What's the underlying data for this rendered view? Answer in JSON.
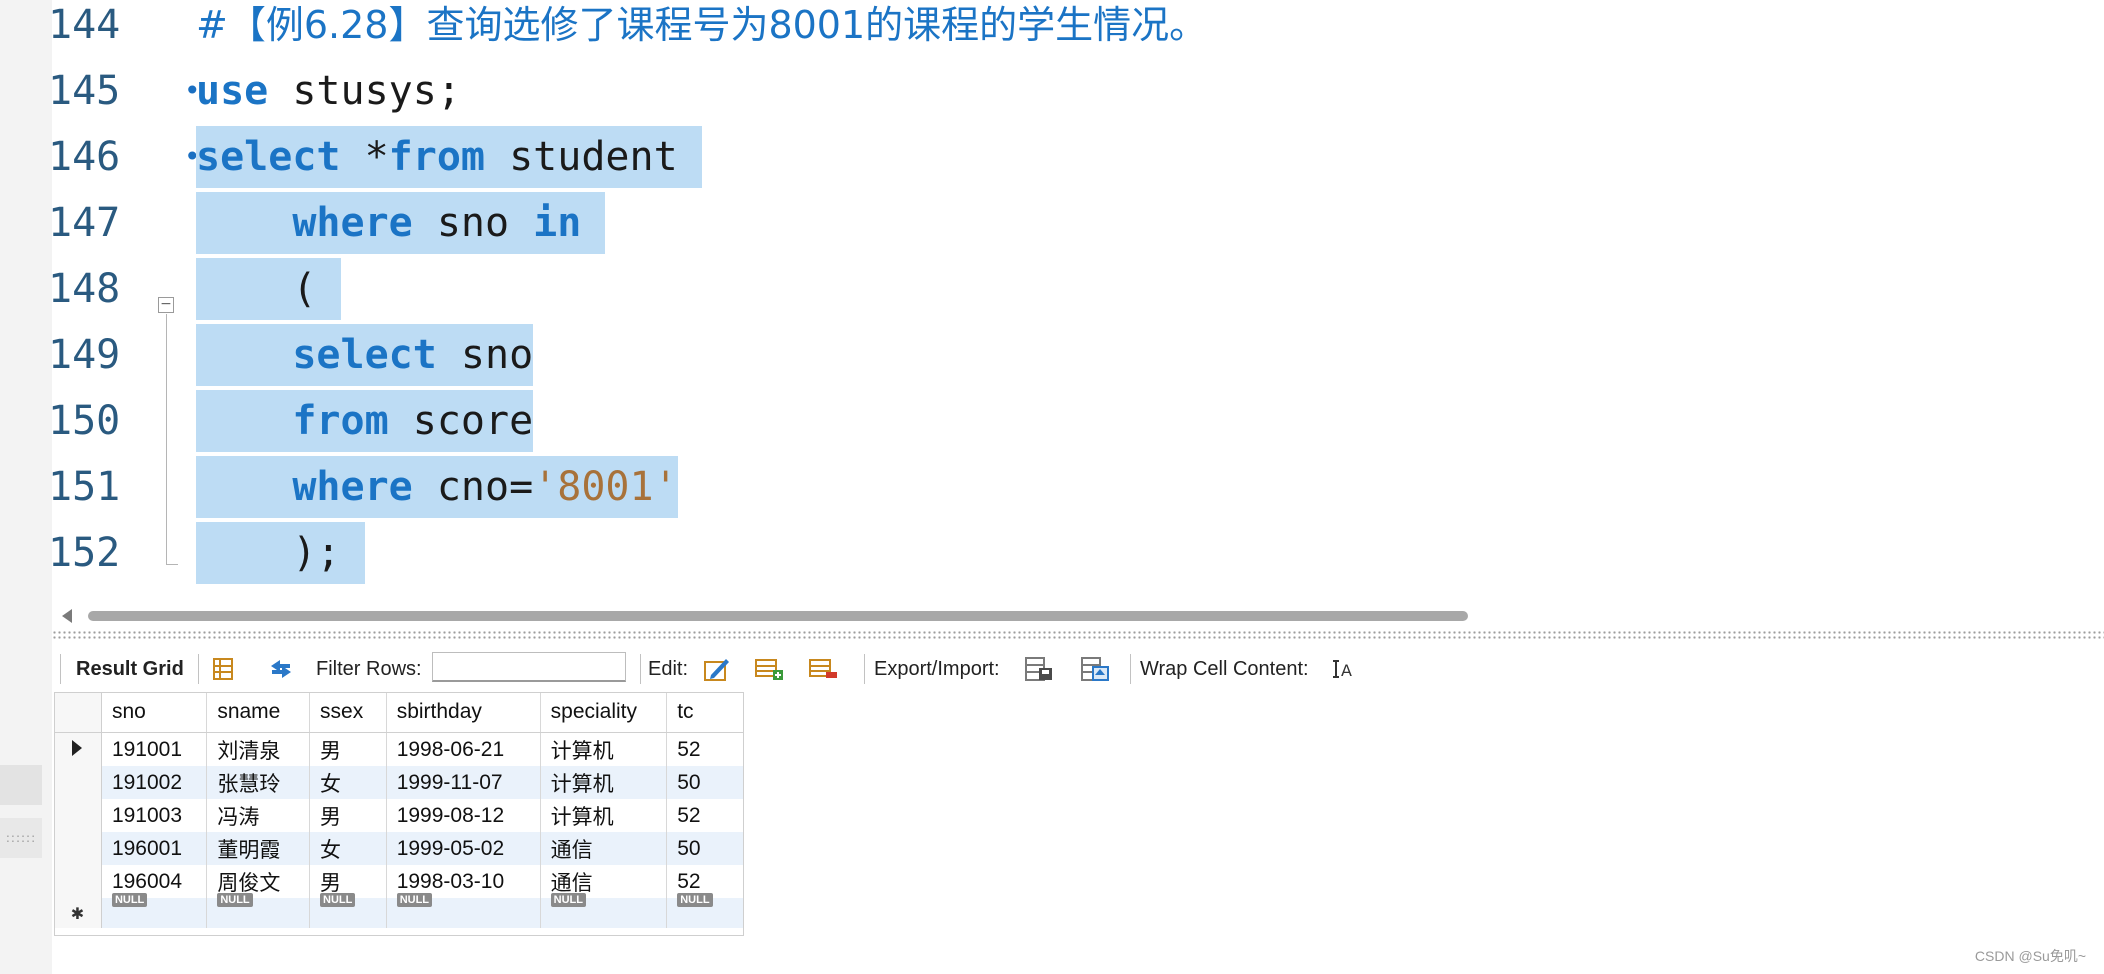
{
  "editor": {
    "lines": [
      {
        "num": "144",
        "tokens": [
          {
            "t": "#【例6.28】查询选修了课程号为8001的课程的学生情况。",
            "c": "cmt"
          }
        ]
      },
      {
        "num": "145",
        "marker": "•",
        "tokens": [
          {
            "t": "use",
            "c": "kw"
          },
          {
            "t": " stusys;"
          }
        ]
      },
      {
        "num": "146",
        "marker": "•",
        "tokens": [
          {
            "t": "select",
            "c": "kw"
          },
          {
            "t": " *"
          },
          {
            "t": "from",
            "c": "kw"
          },
          {
            "t": " student "
          }
        ]
      },
      {
        "num": "147",
        "tokens": [
          {
            "t": "    "
          },
          {
            "t": "where",
            "c": "kw"
          },
          {
            "t": " sno "
          },
          {
            "t": "in",
            "c": "kw"
          },
          {
            "t": " "
          }
        ]
      },
      {
        "num": "148",
        "tokens": [
          {
            "t": "    ( "
          }
        ]
      },
      {
        "num": "149",
        "tokens": [
          {
            "t": "    "
          },
          {
            "t": "select",
            "c": "kw"
          },
          {
            "t": " sno"
          }
        ]
      },
      {
        "num": "150",
        "tokens": [
          {
            "t": "    "
          },
          {
            "t": "from",
            "c": "kw"
          },
          {
            "t": " score"
          }
        ]
      },
      {
        "num": "151",
        "tokens": [
          {
            "t": "    "
          },
          {
            "t": "where",
            "c": "kw"
          },
          {
            "t": " cno="
          },
          {
            "t": "'8001'",
            "c": "str"
          }
        ]
      },
      {
        "num": "152",
        "tokens": [
          {
            "t": "    ); "
          }
        ]
      }
    ]
  },
  "toolbar": {
    "result_grid_label": "Result Grid",
    "filter_rows_label": "Filter Rows:",
    "filter_value": "",
    "edit_label": "Edit:",
    "export_label": "Export/Import:",
    "wrap_label": "Wrap Cell Content:"
  },
  "grid": {
    "columns": [
      "sno",
      "sname",
      "ssex",
      "sbirthday",
      "speciality",
      "tc"
    ],
    "rows": [
      [
        "191001",
        "刘清泉",
        "男",
        "1998-06-21",
        "计算机",
        "52"
      ],
      [
        "191002",
        "张慧玲",
        "女",
        "1999-11-07",
        "计算机",
        "50"
      ],
      [
        "191003",
        "冯涛",
        "男",
        "1999-08-12",
        "计算机",
        "52"
      ],
      [
        "196001",
        "董明霞",
        "女",
        "1999-05-02",
        "通信",
        "50"
      ],
      [
        "196004",
        "周俊文",
        "男",
        "1998-03-10",
        "通信",
        "52"
      ]
    ],
    "null_label": "NULL"
  },
  "left_strip": {
    "dots": "::::::"
  },
  "watermark": "CSDN @Su免叽~",
  "colors": {
    "keyword": "#1b74c5",
    "string": "#a8723a",
    "selection": "#bddcf4",
    "line_number": "#2a5a80"
  }
}
